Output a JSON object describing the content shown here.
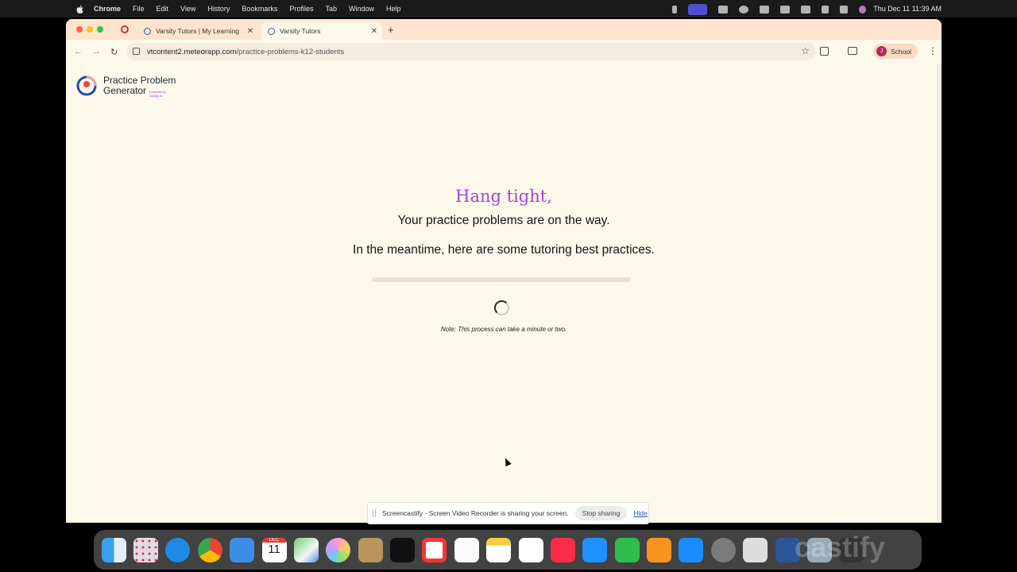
{
  "menubar": {
    "app": "Chrome",
    "menus": [
      "File",
      "Edit",
      "View",
      "History",
      "Bookmarks",
      "Profiles",
      "Tab",
      "Window",
      "Help"
    ],
    "clock": "Thu Dec 11  11:39 AM"
  },
  "browser": {
    "tabs": [
      {
        "title": "Varsity Tutors | My Learning",
        "active": false
      },
      {
        "title": "Varsity Tutors",
        "active": true
      }
    ],
    "url_host": "vtcontent2.meteorapp.com",
    "url_path": "/practice-problems-k12-students",
    "profile_initial": "J",
    "profile_name": "School"
  },
  "page": {
    "logo_line1": "Practice Problem",
    "logo_line2": "Generator",
    "logo_powered": "powered by Varsity AI",
    "heading": "Hang tight,",
    "subheading": "Your practice problems are on the way.",
    "tips_intro": "In the meantime, here are some tutoring best practices.",
    "progress_fraction": 0.0,
    "note": "Note: This process can take a minute or two."
  },
  "sharebar": {
    "message": "Screencastify - Screen Video Recorder is sharing your screen.",
    "stop_label": "Stop sharing",
    "hide_label": "Hide"
  },
  "dock": {
    "calendar_month": "DEC",
    "calendar_day": "11"
  },
  "watermark": {
    "line1": "Made with",
    "line2": "castify"
  },
  "colors": {
    "accent": "#a842d6",
    "page_bg": "#fcf8ea",
    "tabstrip_bg": "#fde4cc"
  }
}
